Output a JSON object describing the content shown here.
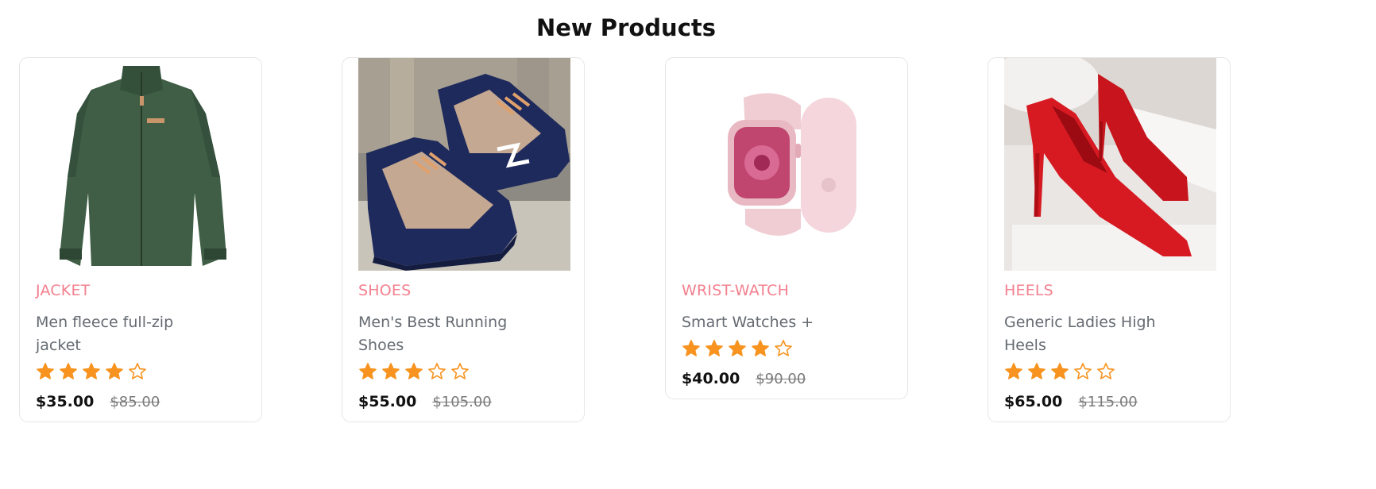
{
  "section": {
    "title": "New Products"
  },
  "products": [
    {
      "category": "JACKET",
      "name": "Men fleece full-zip jacket",
      "rating": 4,
      "rating_max": 5,
      "price": "$35.00",
      "old_price": "$85.00",
      "image_icon": "green-fleece-jacket-image"
    },
    {
      "category": "SHOES",
      "name": "Men's Best Running Shoes",
      "rating": 3,
      "rating_max": 5,
      "price": "$55.00",
      "old_price": "$105.00",
      "image_icon": "navy-running-shoes-image"
    },
    {
      "category": "WRIST-WATCH",
      "name": "Smart Watches +",
      "rating": 4,
      "rating_max": 5,
      "price": "$40.00",
      "old_price": "$90.00",
      "image_icon": "pink-smart-watch-image"
    },
    {
      "category": "HEELS",
      "name": "Generic Ladies High Heels",
      "rating": 3,
      "rating_max": 5,
      "price": "$65.00",
      "old_price": "$115.00",
      "image_icon": "red-high-heels-image"
    }
  ],
  "colors": {
    "category": "#f3808f",
    "star": "#f7931e",
    "price": "#111111",
    "old_price": "#7a7a7a",
    "name": "#666b72"
  }
}
